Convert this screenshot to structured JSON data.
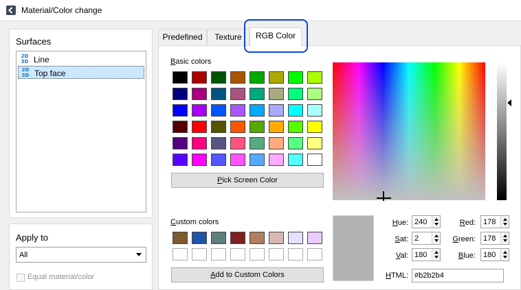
{
  "window": {
    "title": "Material/Color change",
    "icon": "back-arrow-icon"
  },
  "surfaces": {
    "heading": "Surfaces",
    "items": [
      {
        "icon_text": "2D 3D",
        "label": "Line",
        "selected": false
      },
      {
        "icon_text": "2D 3D",
        "label": "Top face",
        "selected": true
      }
    ]
  },
  "apply": {
    "heading": "Apply to",
    "select_value": "All",
    "checkbox_label": "Equal material/color",
    "checkbox_checked": false
  },
  "tabs": [
    {
      "label": "Predefined",
      "active": false
    },
    {
      "label": "Texture",
      "active": false
    },
    {
      "label": "RGB Color",
      "active": true
    }
  ],
  "rgb": {
    "basic_colors_label": "Basic colors",
    "basic_colors": [
      [
        "#000000",
        "#aa0000",
        "#005500",
        "#aa5500",
        "#00aa00",
        "#aaaa00",
        "#00ff00",
        "#aaff00"
      ],
      [
        "#00007f",
        "#aa007f",
        "#00557f",
        "#aa557f",
        "#00aa7f",
        "#aaaa7f",
        "#00ff7f",
        "#aaff7f"
      ],
      [
        "#0000ff",
        "#aa00ff",
        "#0055ff",
        "#aa55ff",
        "#00aaff",
        "#aaaaff",
        "#00ffff",
        "#aaffff"
      ],
      [
        "#550000",
        "#ff0000",
        "#555500",
        "#ff5500",
        "#55aa00",
        "#ffaa00",
        "#55ff00",
        "#ffff00"
      ],
      [
        "#55007f",
        "#ff007f",
        "#55557f",
        "#ff557f",
        "#55aa7f",
        "#ffaa7f",
        "#55ff7f",
        "#ffff7f"
      ],
      [
        "#5500ff",
        "#ff00ff",
        "#5555ff",
        "#ff55ff",
        "#55aaff",
        "#ffaaff",
        "#55ffff",
        "#ffffff"
      ]
    ],
    "pick_screen_label": "Pick Screen Color",
    "custom_colors_label": "Custom colors",
    "custom_colors": [
      [
        "#7f5a2e",
        "#1f55aa",
        "#5f7f7f",
        "#7f1f1f",
        "#b07f60",
        "#d8b8b2",
        "#e8e0ff",
        "#e8ccff"
      ],
      [
        "#ffffff",
        "#ffffff",
        "#ffffff",
        "#ffffff",
        "#ffffff",
        "#ffffff",
        "#ffffff",
        "#ffffff"
      ]
    ],
    "add_custom_label": "Add to Custom Colors",
    "preview_color": "#b2b2b4",
    "fields": {
      "hue_label": "Hue:",
      "hue": "240",
      "sat_label": "Sat:",
      "sat": "2",
      "val_label": "Val:",
      "val": "180",
      "red_label": "Red:",
      "red": "178",
      "green_label": "Green:",
      "green": "178",
      "blue_label": "Blue:",
      "blue": "180",
      "html_label": "HTML:",
      "html": "#b2b2b4"
    }
  },
  "colors": {
    "highlight": "#1144dd",
    "selection": "#cce8ff"
  }
}
